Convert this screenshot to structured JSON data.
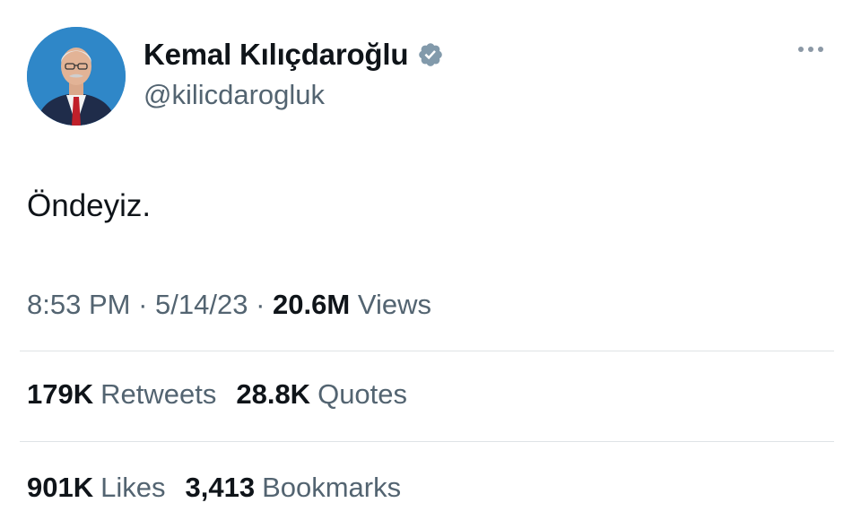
{
  "author": {
    "display_name": "Kemal Kılıçdaroğlu",
    "handle": "@kilicdarogluk",
    "verified_icon": "verified-badge-icon",
    "avatar_bg_color": "#2f87c8"
  },
  "tweet": {
    "text": "Öndeyiz.",
    "time": "8:53 PM",
    "date": "5/14/23",
    "separator": "·",
    "views_count": "20.6M",
    "views_label": "Views"
  },
  "stats": {
    "retweets_count": "179K",
    "retweets_label": "Retweets",
    "quotes_count": "28.8K",
    "quotes_label": "Quotes",
    "likes_count": "901K",
    "likes_label": "Likes",
    "bookmarks_count": "3,413",
    "bookmarks_label": "Bookmarks"
  },
  "icons": {
    "more": "more-options-icon"
  },
  "colors": {
    "text_primary": "#0f1419",
    "text_secondary": "#536471",
    "divider": "#dfe3e6"
  }
}
